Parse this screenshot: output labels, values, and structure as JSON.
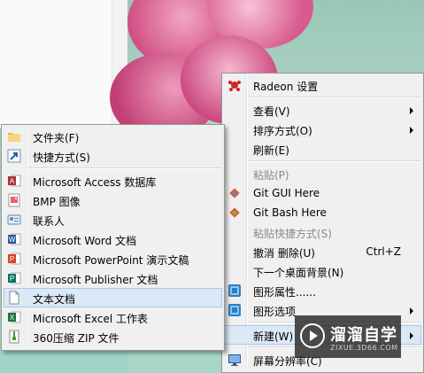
{
  "right_menu": {
    "items": [
      {
        "label": "Radeon 设置",
        "icon": "radeon-icon"
      },
      {
        "label": "查看(V)",
        "submenu": true
      },
      {
        "label": "排序方式(O)",
        "submenu": true
      },
      {
        "label": "刷新(E)"
      },
      {
        "label": "粘贴(P)",
        "disabled": true
      },
      {
        "label": "Git GUI Here",
        "icon": "git-gui-icon"
      },
      {
        "label": "Git Bash Here",
        "icon": "git-bash-icon"
      },
      {
        "label": "粘贴快捷方式(S)",
        "disabled": true
      },
      {
        "label": "撤消 删除(U)",
        "shortcut": "Ctrl+Z"
      },
      {
        "label": "下一个桌面背景(N)"
      },
      {
        "label": "图形属性......",
        "icon": "graphics-properties-icon"
      },
      {
        "label": "图形选项",
        "icon": "graphics-options-icon",
        "submenu": true
      },
      {
        "label": "新建(W)",
        "submenu": true,
        "highlighted": true
      },
      {
        "label": "屏幕分辨率(C)",
        "icon": "screen-resolution-icon"
      }
    ]
  },
  "new_submenu": {
    "items": [
      {
        "label": "文件夹(F)",
        "icon": "folder-icon"
      },
      {
        "label": "快捷方式(S)",
        "icon": "shortcut-icon"
      },
      {
        "label": "Microsoft Access 数据库",
        "icon": "access-icon"
      },
      {
        "label": "BMP 图像",
        "icon": "bmp-image-icon"
      },
      {
        "label": "联系人",
        "icon": "contact-icon"
      },
      {
        "label": "Microsoft Word 文档",
        "icon": "word-icon"
      },
      {
        "label": "Microsoft PowerPoint 演示文稿",
        "icon": "powerpoint-icon"
      },
      {
        "label": "Microsoft Publisher 文档",
        "icon": "publisher-icon"
      },
      {
        "label": "文本文档",
        "icon": "text-document-icon",
        "highlighted": true
      },
      {
        "label": "Microsoft Excel 工作表",
        "icon": "excel-icon"
      },
      {
        "label": "360压缩 ZIP 文件",
        "icon": "zip-icon"
      }
    ]
  },
  "watermark": {
    "title": "溜溜自学",
    "subtitle": "ZIXUE.3D66.COM"
  },
  "colors": {
    "menu_bg": "#f0f0f0",
    "highlight_bg": "#dce8f6",
    "highlight_border": "#a8c8ec",
    "disabled_text": "#8a8a8a"
  }
}
